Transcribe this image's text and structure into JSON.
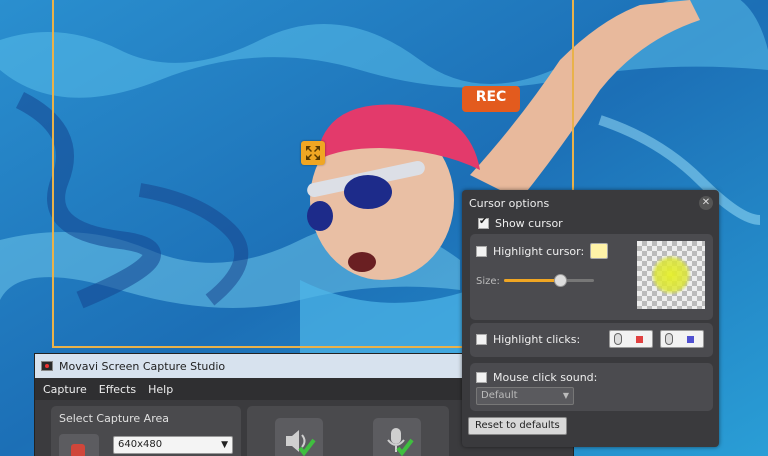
{
  "app": {
    "title": "Movavi Screen Capture Studio",
    "menu": [
      "Capture",
      "Effects",
      "Help"
    ],
    "capture_area": {
      "label": "Select Capture Area",
      "selected": "640x480"
    },
    "rec_label": "REC"
  },
  "cursor_options": {
    "title": "Cursor options",
    "close_glyph": "✕",
    "show_cursor": {
      "label": "Show cursor",
      "checked": true
    },
    "highlight_cursor": {
      "label": "Highlight cursor:",
      "checked": false,
      "color": "#fff3a8"
    },
    "size": {
      "label": "Size:",
      "value": 0.62
    },
    "highlight_clicks": {
      "label": "Highlight clicks:",
      "checked": false,
      "left_color": "#e04040",
      "right_color": "#5050d0"
    },
    "mouse_click_sound": {
      "label": "Mouse click sound:",
      "checked": false,
      "selected": "Default"
    },
    "reset_label": "Reset to defaults"
  },
  "colors": {
    "accent": "#f0a623",
    "frame": "#e9b24a",
    "panel": "#3a3a3d"
  }
}
